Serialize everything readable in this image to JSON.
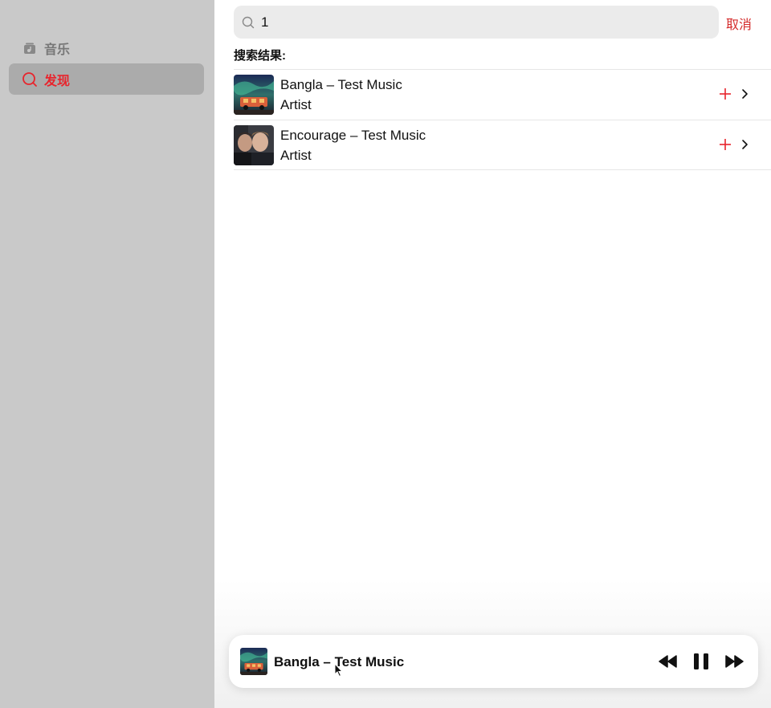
{
  "sidebar": {
    "items": [
      {
        "label": "音乐",
        "icon": "music-icon",
        "active": false
      },
      {
        "label": "发现",
        "icon": "search-icon",
        "active": true
      }
    ]
  },
  "search": {
    "value": "1",
    "cancel_label": "取消"
  },
  "results": {
    "title": "搜索结果:",
    "items": [
      {
        "title": "Bangla – Test Music",
        "subtitle": "Artist",
        "add_icon": "plus-icon",
        "more_icon": "chevron-right-icon"
      },
      {
        "title": "Encourage – Test Music",
        "subtitle": "Artist",
        "add_icon": "plus-icon",
        "more_icon": "chevron-right-icon"
      }
    ]
  },
  "player": {
    "now_playing": "Bangla – Test Music",
    "controls": [
      "rewind-icon",
      "pause-icon",
      "fast-forward-icon"
    ]
  },
  "colors": {
    "accent": "#e8242c",
    "sidebar_bg": "#c9c9c9",
    "sidebar_active_bg": "#ababab",
    "search_bg": "#ebebeb"
  }
}
